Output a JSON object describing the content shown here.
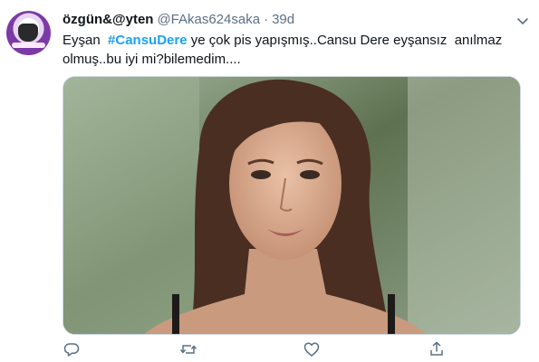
{
  "tweet": {
    "author_name": "özgün&@yten",
    "handle": "@FAkas624saka",
    "separator": "·",
    "time": "39d",
    "text_part1": "Eyşan  ",
    "hashtag": "#CansuDere",
    "text_part2": " ye çok pis yapışmış..Cansu Dere eyşansız  anılmaz olmuş..bu iyi mi?bilemedim....",
    "media_description_icon": "photo",
    "actions": [
      {
        "name": "reply-icon"
      },
      {
        "name": "retweet-icon"
      },
      {
        "name": "like-icon"
      },
      {
        "name": "share-icon"
      }
    ]
  },
  "colors": {
    "link": "#1da1f2",
    "secondary_text": "#5b7083",
    "border": "#cfd9de"
  }
}
